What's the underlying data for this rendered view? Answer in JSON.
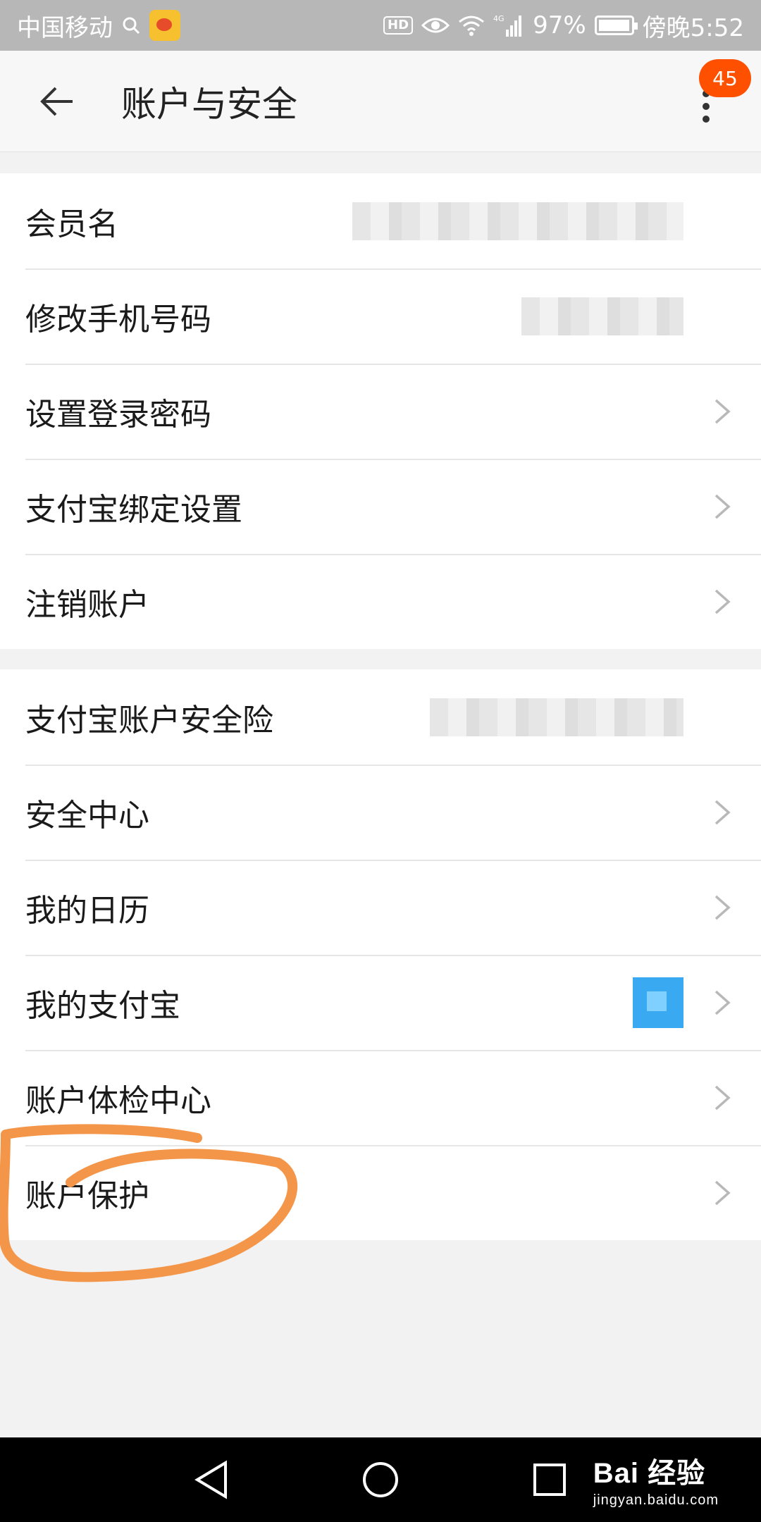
{
  "status_bar": {
    "carrier": "中国移动",
    "hd": "HD",
    "network": "4G",
    "battery": "97%",
    "time": "傍晚5:52"
  },
  "header": {
    "title": "账户与安全",
    "badge_count": "45"
  },
  "groups": [
    {
      "items": [
        {
          "label": "会员名",
          "trailing": "redacted"
        },
        {
          "label": "修改手机号码",
          "trailing": "redacted"
        },
        {
          "label": "设置登录密码",
          "trailing": "chevron"
        },
        {
          "label": "支付宝绑定设置",
          "trailing": "chevron"
        },
        {
          "label": "注销账户",
          "trailing": "chevron"
        }
      ]
    },
    {
      "items": [
        {
          "label": "支付宝账户安全险",
          "trailing": "redacted"
        },
        {
          "label": "安全中心",
          "trailing": "chevron"
        },
        {
          "label": "我的日历",
          "trailing": "chevron"
        },
        {
          "label": "我的支付宝",
          "trailing": "image+chevron"
        },
        {
          "label": "账户体检中心",
          "trailing": "chevron"
        },
        {
          "label": "账户保护",
          "trailing": "chevron",
          "highlighted": true
        }
      ]
    }
  ],
  "watermark": {
    "main": "Bai 经验",
    "sub": "jingyan.baidu.com"
  },
  "colors": {
    "accent": "#ff5000",
    "annotation": "#f4964a"
  },
  "icons": {
    "back": "arrow-left-icon",
    "more": "more-vertical-icon",
    "chevron": "chevron-right-icon",
    "nav_back": "triangle-back-icon",
    "nav_home": "circle-home-icon",
    "nav_recent": "square-recent-icon"
  }
}
